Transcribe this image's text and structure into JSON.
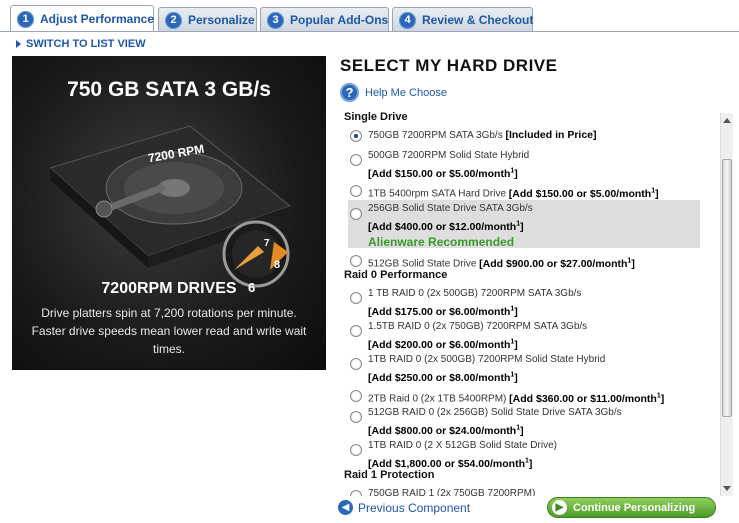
{
  "tabs": [
    {
      "num": "1",
      "label": "Adjust Performance"
    },
    {
      "num": "2",
      "label": "Personalize"
    },
    {
      "num": "3",
      "label": "Popular Add-Ons"
    },
    {
      "num": "4",
      "label": "Review & Checkout"
    }
  ],
  "switch_link": "SWITCH TO LIST VIEW",
  "hero": {
    "title": "750 GB SATA 3 GB/s",
    "rpm_label": "7200 RPM",
    "subtitle": "7200RPM DRIVES",
    "description": "Drive platters spin at 7,200 rotations per minute. Faster drive speeds mean lower read and write wait times.",
    "dial_numbers": [
      "6",
      "7",
      "8"
    ]
  },
  "section": {
    "title": "SELECT MY HARD DRIVE",
    "help_icon": "?",
    "help_text": "Help Me Choose"
  },
  "groups": {
    "single": "Single Drive",
    "raid0": "Raid 0 Performance",
    "raid1": "Raid 1 Protection"
  },
  "options": [
    {
      "name": "750GB 7200RPM SATA 3Gb/s",
      "price": "[Included in Price]"
    },
    {
      "name": "500GB 7200RPM Solid State Hybrid",
      "price": "[Add $150.00 or $5.00/month",
      "sup": "1",
      "close": "]"
    },
    {
      "name": "1TB 5400rpm SATA Hard Drive",
      "price": "[Add $150.00 or $5.00/month",
      "sup": "1",
      "close": "]"
    },
    {
      "name": "256GB Solid State Drive SATA 3Gb/s",
      "price": "[Add $400.00 or $12.00/month",
      "sup": "1",
      "close": "]",
      "recommended": "Alienware Recommended"
    },
    {
      "name": "512GB Solid State Drive",
      "price": "[Add $900.00 or $27.00/month",
      "sup": "1",
      "close": "]"
    },
    {
      "name": "1 TB RAID 0 (2x 500GB) 7200RPM SATA 3Gb/s",
      "price": "[Add $175.00 or $6.00/month",
      "sup": "1",
      "close": "]"
    },
    {
      "name": "1.5TB RAID 0 (2x 750GB) 7200RPM SATA 3Gb/s",
      "price": "[Add $200.00 or $6.00/month",
      "sup": "1",
      "close": "]"
    },
    {
      "name": "1TB RAID 0 (2x 500GB) 7200RPM Solid State Hybrid",
      "price": "[Add $250.00 or $8.00/month",
      "sup": "1",
      "close": "]"
    },
    {
      "name": "2TB Raid 0 (2x 1TB 5400RPM)",
      "price": "[Add $360.00 or $11.00/month",
      "sup": "1",
      "close": "]"
    },
    {
      "name": "512GB RAID 0 (2x 256GB) Solid State Drive SATA 3Gb/s",
      "price": "[Add $800.00 or $24.00/month",
      "sup": "1",
      "close": "]"
    },
    {
      "name": "1TB RAID 0 (2 X 512GB Solid State Drive)",
      "price": "[Add $1,800.00 or $54.00/month",
      "sup": "1",
      "close": "]"
    },
    {
      "name": "750GB RAID 1 (2x 750GB 7200RPM)",
      "price": ""
    }
  ],
  "footer": {
    "previous": "Previous Component",
    "continue": "Continue Personalizing"
  },
  "colors": {
    "link": "#1e56a8",
    "recommended": "#3a9a2a",
    "continue": "#4f9b2a"
  }
}
